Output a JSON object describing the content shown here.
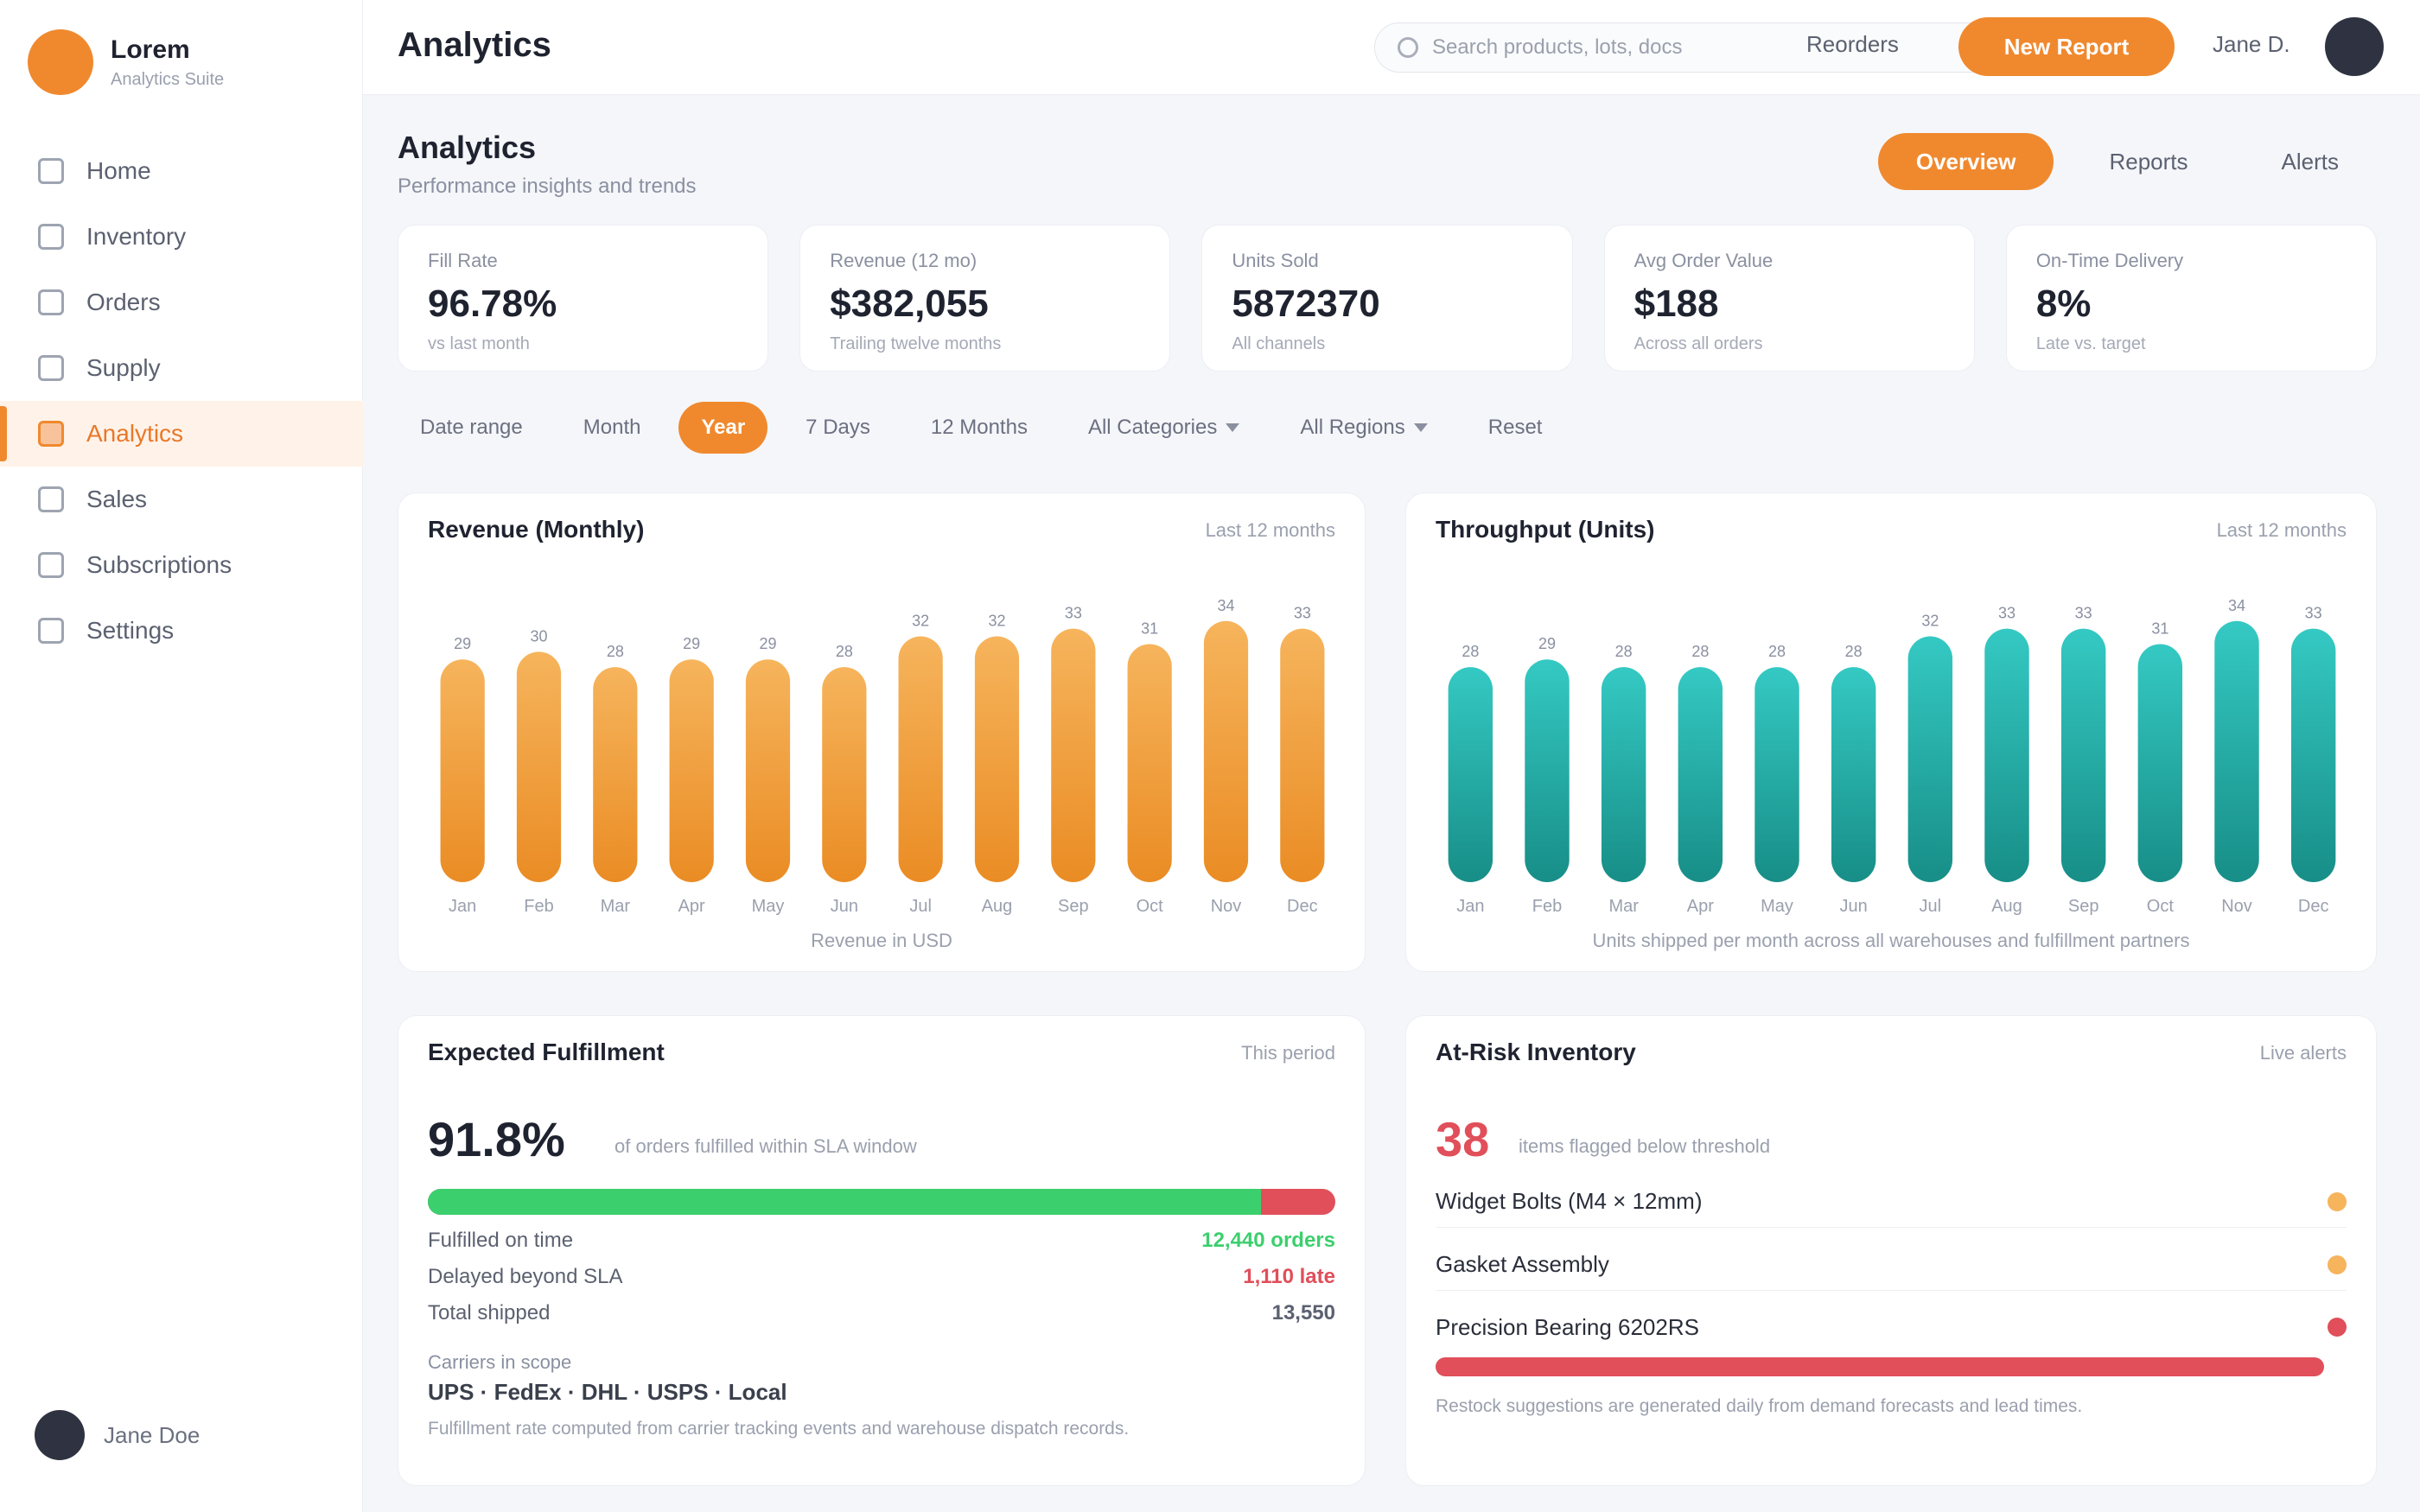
{
  "brand": {
    "name": "Lorem",
    "subtitle": "Analytics Suite"
  },
  "sidebar": {
    "items": [
      {
        "label": "Home",
        "active": false
      },
      {
        "label": "Inventory",
        "active": false
      },
      {
        "label": "Orders",
        "active": false
      },
      {
        "label": "Supply",
        "active": false
      },
      {
        "label": "Analytics",
        "active": true
      },
      {
        "label": "Sales",
        "active": false
      },
      {
        "label": "Subscriptions",
        "active": false
      },
      {
        "label": "Settings",
        "active": false
      }
    ],
    "user_name": "Jane Doe"
  },
  "topbar": {
    "title": "Analytics",
    "search_placeholder": "Search products, lots, docs",
    "link_label": "Reorders",
    "cta_label": "New Report",
    "user_label": "Jane D."
  },
  "page": {
    "title": "Analytics",
    "subtitle": "Performance insights and trends",
    "view_tabs": [
      {
        "label": "Overview",
        "active": true
      },
      {
        "label": "Reports",
        "active": false
      },
      {
        "label": "Alerts",
        "active": false
      }
    ]
  },
  "kpis": [
    {
      "label": "Fill Rate",
      "value": "96.78%",
      "sub": "vs last month"
    },
    {
      "label": "Revenue (12 mo)",
      "value": "$382,055",
      "sub": "Trailing twelve months"
    },
    {
      "label": "Units Sold",
      "value": "5872370",
      "sub": "All channels"
    },
    {
      "label": "Avg Order Value",
      "value": "$188",
      "sub": "Across all orders"
    },
    {
      "label": "On-Time Delivery",
      "value": "8%",
      "sub": "Late vs. target"
    }
  ],
  "filters": [
    {
      "label": "Date range",
      "active": false,
      "dropdown": false
    },
    {
      "label": "Month",
      "active": false,
      "dropdown": false
    },
    {
      "label": "Year",
      "active": true,
      "dropdown": false
    },
    {
      "label": "7 Days",
      "active": false,
      "dropdown": false
    },
    {
      "label": "12 Months",
      "active": false,
      "dropdown": false
    },
    {
      "label": "All Categories",
      "active": false,
      "dropdown": true
    },
    {
      "label": "All Regions",
      "active": false,
      "dropdown": true
    },
    {
      "label": "Reset",
      "active": false,
      "dropdown": false
    }
  ],
  "colors": {
    "accent": "#f0892e",
    "bar_orange_top": "#f6b45c",
    "bar_orange_bottom": "#ea8c24",
    "bar_teal_top": "#35c9c3",
    "bar_teal_bottom": "#178e87",
    "good": "#3ccf6e",
    "bad": "#e04f5a"
  },
  "charts": {
    "revenue": {
      "title": "Revenue (Monthly)",
      "meta": "Last 12 months",
      "caption": "Revenue in USD"
    },
    "throughput": {
      "title": "Throughput (Units)",
      "meta": "Last 12 months",
      "caption": "Units shipped per month across all warehouses and fulfillment partners"
    }
  },
  "chart_data": [
    {
      "type": "bar",
      "title": "Revenue (Monthly)",
      "categories": [
        "Jan",
        "Feb",
        "Mar",
        "Apr",
        "May",
        "Jun",
        "Jul",
        "Aug",
        "Sep",
        "Oct",
        "Nov",
        "Dec"
      ],
      "values": [
        29,
        30,
        28,
        29,
        29,
        28,
        32,
        32,
        33,
        31,
        34,
        33
      ],
      "ylim": [
        0,
        36
      ]
    },
    {
      "type": "bar",
      "title": "Throughput (Units)",
      "categories": [
        "Jan",
        "Feb",
        "Mar",
        "Apr",
        "May",
        "Jun",
        "Jul",
        "Aug",
        "Sep",
        "Oct",
        "Nov",
        "Dec"
      ],
      "values": [
        28,
        29,
        28,
        28,
        28,
        28,
        32,
        33,
        33,
        31,
        34,
        33
      ],
      "ylim": [
        0,
        36
      ]
    }
  ],
  "fulfillment": {
    "title": "Expected Fulfillment",
    "meta": "This period",
    "big_value": "91.8%",
    "note": "of orders fulfilled within SLA window",
    "bar_good_fraction": 0.918,
    "rows": [
      {
        "label": "Fulfilled on time",
        "value": "12,440 orders",
        "tone": "good"
      },
      {
        "label": "Delayed beyond SLA",
        "value": "1,110 late",
        "tone": "bad"
      },
      {
        "label": "Total shipped",
        "value": "13,550"
      }
    ],
    "foot_label": "Carriers in scope",
    "foot_values": "UPS · FedEx · DHL · USPS · Local",
    "foot_note": "Fulfillment rate computed from carrier tracking events and warehouse dispatch records."
  },
  "alerts": {
    "title": "At-Risk Inventory",
    "meta": "Live alerts",
    "count": "38",
    "count_note": "items flagged below threshold",
    "items": [
      {
        "label": "Widget Bolts (M4 × 12mm)",
        "tone": "warn"
      },
      {
        "label": "Gasket Assembly",
        "tone": "warn"
      },
      {
        "label": "Precision Bearing 6202RS",
        "tone": "bad"
      }
    ],
    "footer": "Restock suggestions are generated daily from demand forecasts and lead times."
  }
}
